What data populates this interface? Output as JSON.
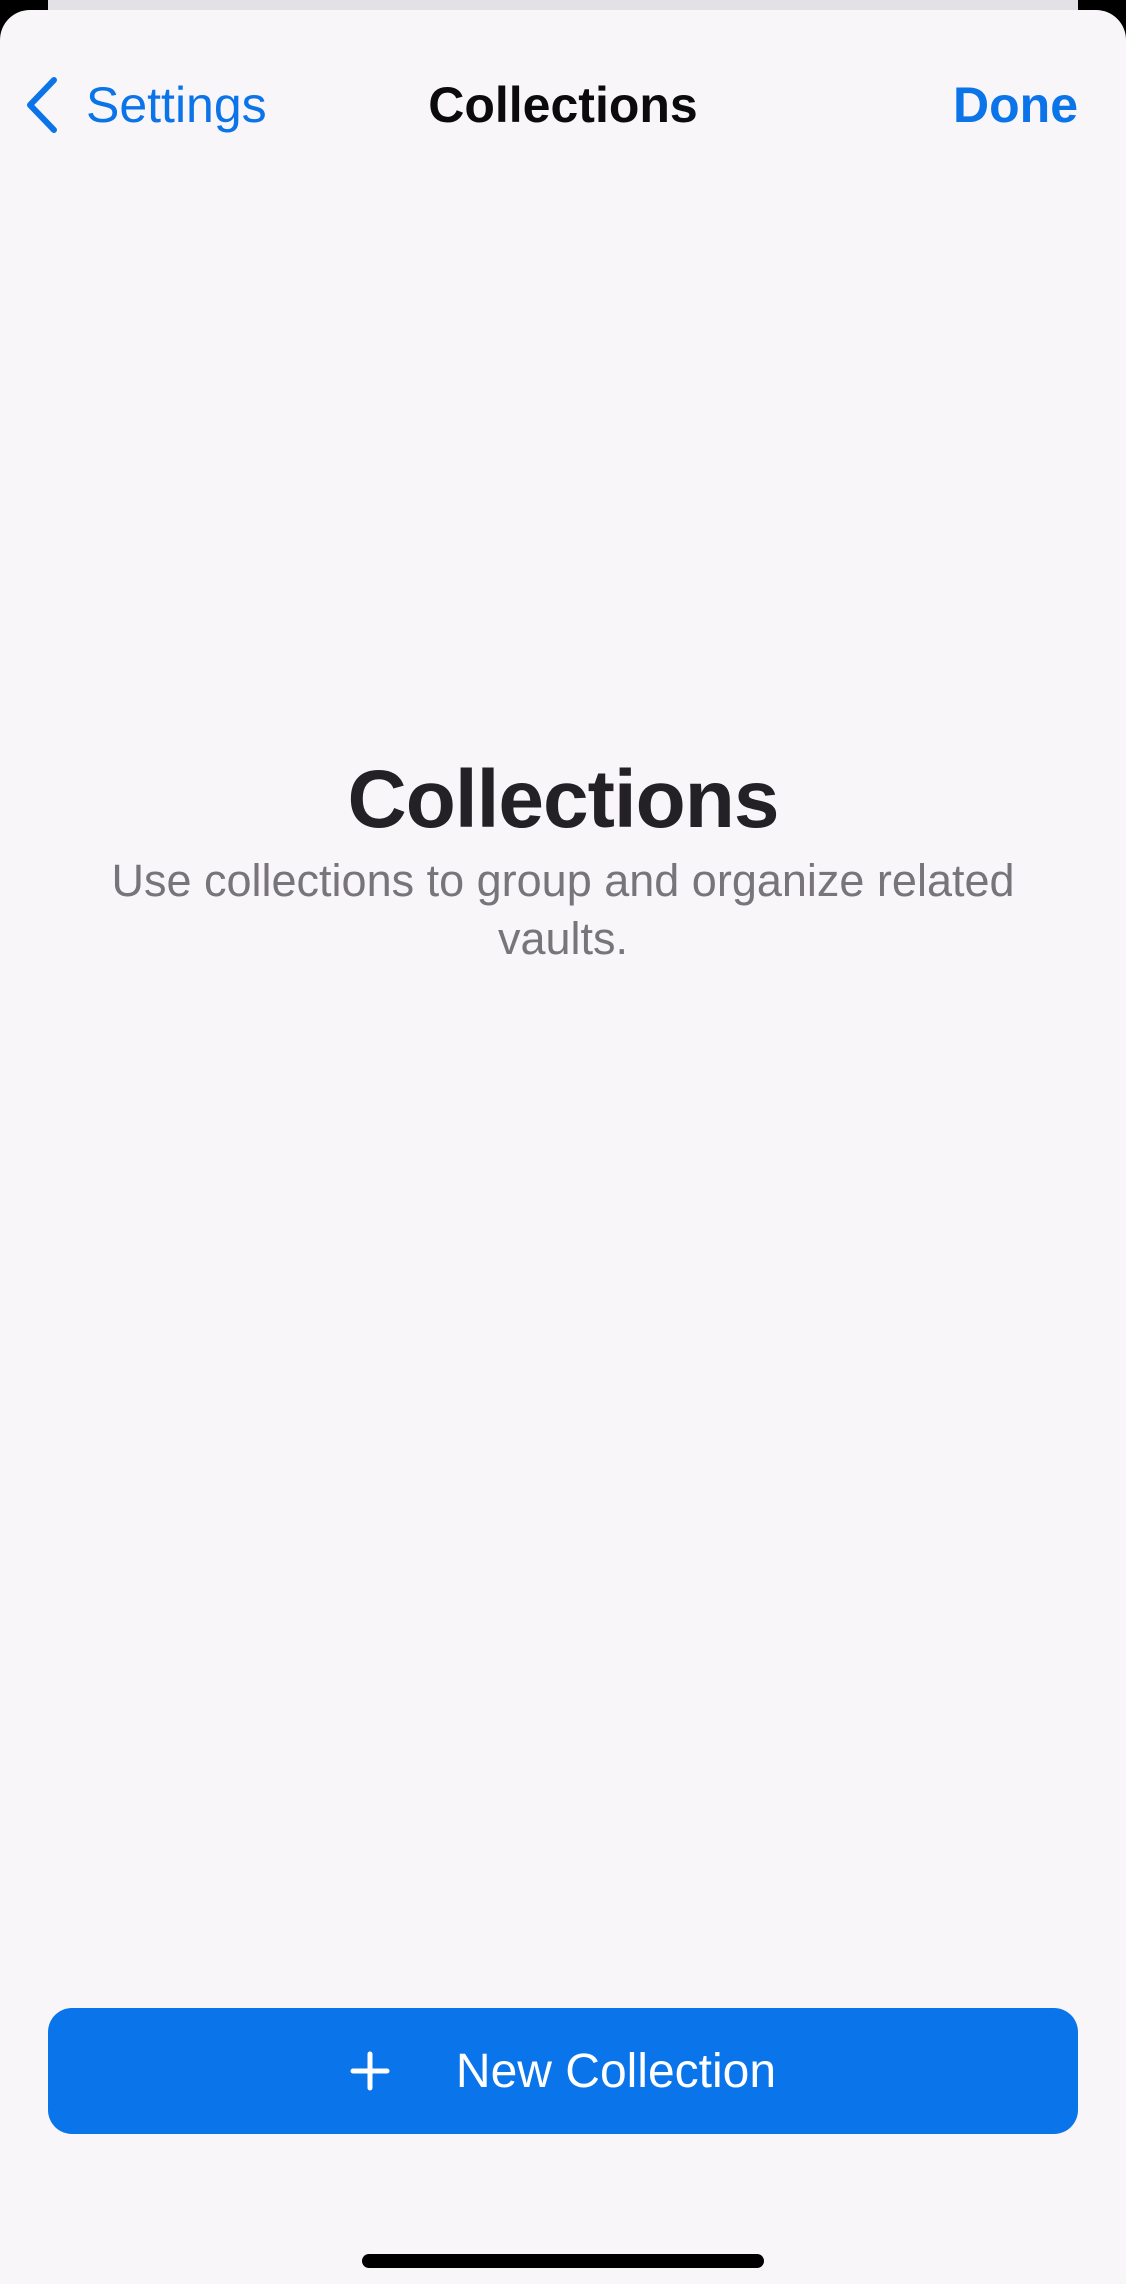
{
  "nav": {
    "back_label": "Settings",
    "title": "Collections",
    "done_label": "Done"
  },
  "empty_state": {
    "title": "Collections",
    "description": "Use collections to group and organize related vaults."
  },
  "actions": {
    "new_collection_label": "New Collection"
  },
  "icons": {
    "back": "chevron-left-icon",
    "add": "plus-icon"
  },
  "colors": {
    "accent": "#0a74e8",
    "background": "#f9f6f9",
    "title_text": "#232126",
    "secondary_text": "#77747a"
  }
}
